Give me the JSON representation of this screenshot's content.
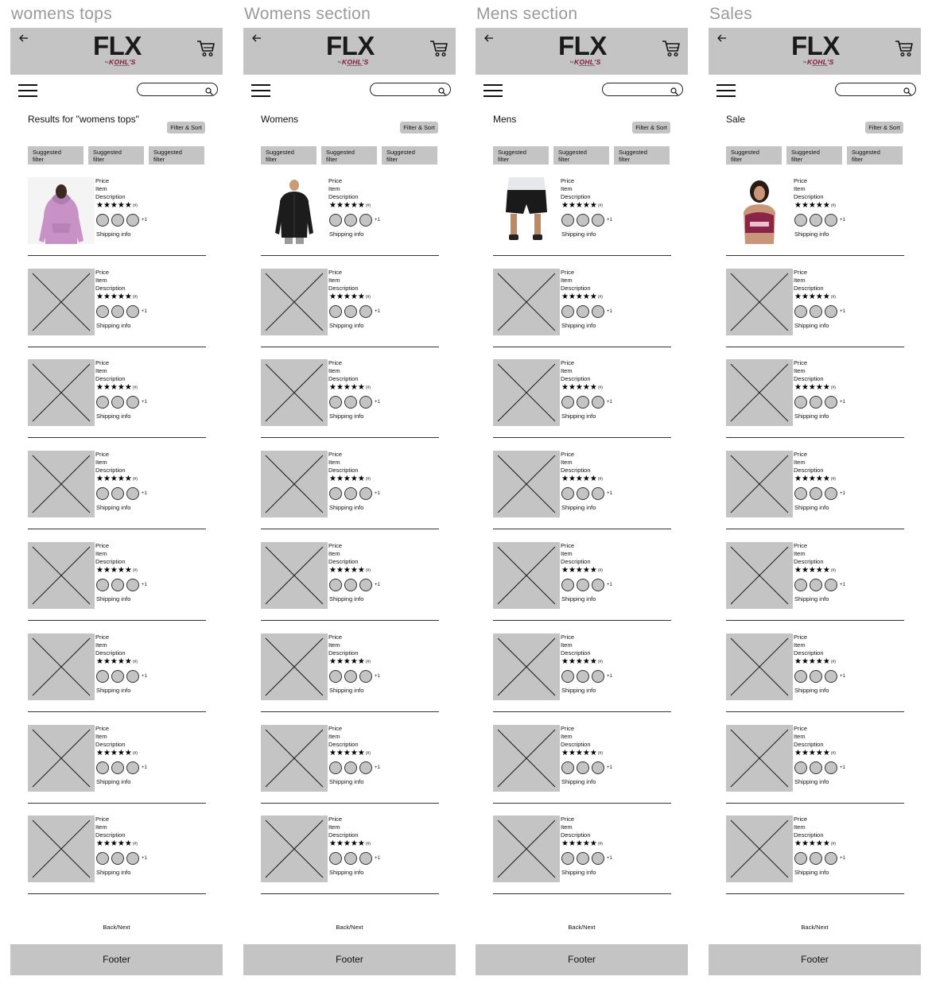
{
  "frames": [
    {
      "title": "womens tops",
      "heading": "Results for \"womens tops\"",
      "photo": "hoodie-lavender"
    },
    {
      "title": "Womens section",
      "heading": "Womens",
      "photo": "jacket-black"
    },
    {
      "title": "Mens section",
      "heading": "Mens",
      "photo": "shorts-black"
    },
    {
      "title": "Sales",
      "heading": "Sale",
      "photo": "sports-bra"
    }
  ],
  "header": {
    "logo": "FLX",
    "logo_by": "by",
    "logo_brand": "KOHL'S",
    "back_icon": "back-arrow-icon",
    "cart_icon": "cart-icon",
    "menu_icon": "hamburger-menu-icon",
    "search_icon": "search-icon",
    "search_placeholder": ""
  },
  "filter_sort_label": "Filter & Sort",
  "suggested_filters": [
    "Suggested\nfilter",
    "Suggested\nfilter",
    "Suggested\nfilter"
  ],
  "product_template": {
    "price": "Price",
    "item": "Item",
    "description": "Description",
    "stars": "★★★★★",
    "rating_count": "(#)",
    "more_colors": "+1",
    "shipping": "Shipping info"
  },
  "products_per_frame": 8,
  "pagination": "Back/Next",
  "footer": "Footer",
  "colors": {
    "placeholder_gray": "#c4c4c4",
    "frame_title": "#9a9a9a",
    "brand_red": "#8b1538",
    "hoodie": "#c992c6",
    "bra": "#8b2448"
  }
}
